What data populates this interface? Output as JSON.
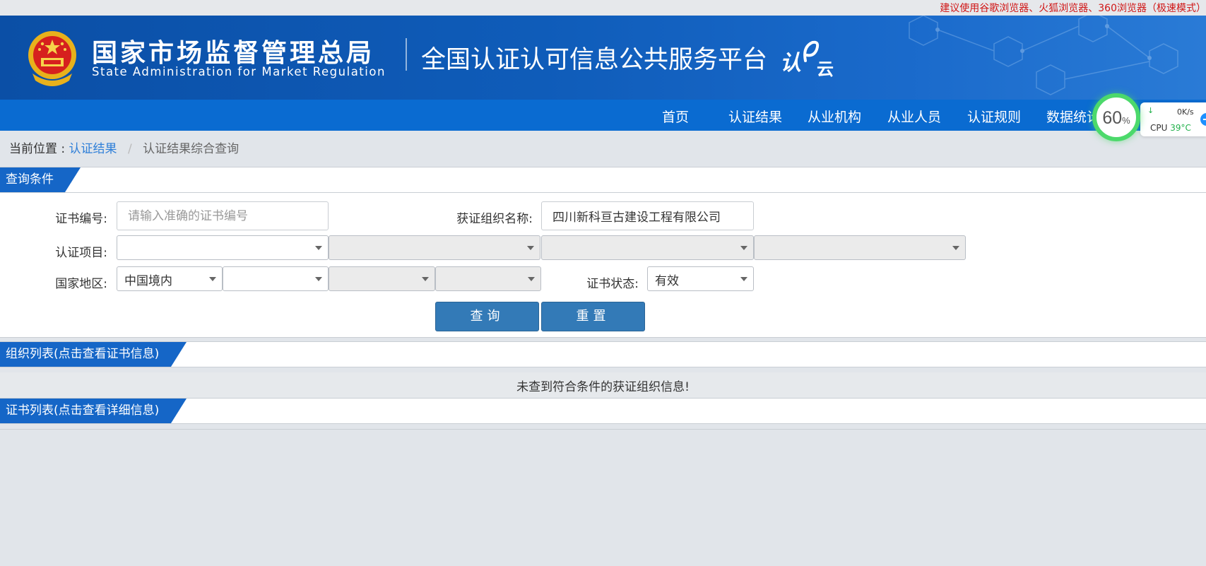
{
  "topbar": {
    "tip": "建议使用谷歌浏览器、火狐浏览器、360浏览器（极速模式）"
  },
  "header": {
    "agency_cn": "国家市场监督管理总局",
    "agency_en": "State Administration  for  Market Regulation",
    "platform_title": "全国认证认可信息公共服务平台",
    "brand_text": "认",
    "brand_sub": "云"
  },
  "nav": {
    "items": [
      "首页",
      "认证结果",
      "从业机构",
      "从业人员",
      "认证规则",
      "数据统计"
    ]
  },
  "widget": {
    "percent": "60",
    "percent_unit": "%",
    "net_speed": "0K/s",
    "cpu_label": "CPU",
    "cpu_temp": "39°C",
    "cpu_load_percent": 60
  },
  "breadcrumb": {
    "label": "当前位置 :",
    "link": "认证结果",
    "separator": "/",
    "current": "认证结果综合查询"
  },
  "query": {
    "section_title": "查询条件",
    "cert_no_label": "证书编号:",
    "cert_no_placeholder": "请输入准确的证书编号",
    "cert_no_value": "",
    "org_name_label": "获证组织名称:",
    "org_name_value": "四川新科亘古建设工程有限公司",
    "project_label": "认证项目:",
    "region_label": "国家地区:",
    "region_value": "中国境内",
    "status_label": "证书状态:",
    "status_value": "有效",
    "search_button": "查询",
    "reset_button": "重置"
  },
  "org_list": {
    "section_title": "组织列表(点击查看证书信息)",
    "empty_message": "未查到符合条件的获证组织信息!"
  },
  "cert_list": {
    "section_title": "证书列表(点击查看详细信息)"
  },
  "colors": {
    "banner": "#0f5cb9",
    "nav": "#0a6bd1",
    "section_tab": "#1566c7",
    "button": "#337ab7",
    "tip": "#d01616",
    "link": "#2f7fd8"
  }
}
